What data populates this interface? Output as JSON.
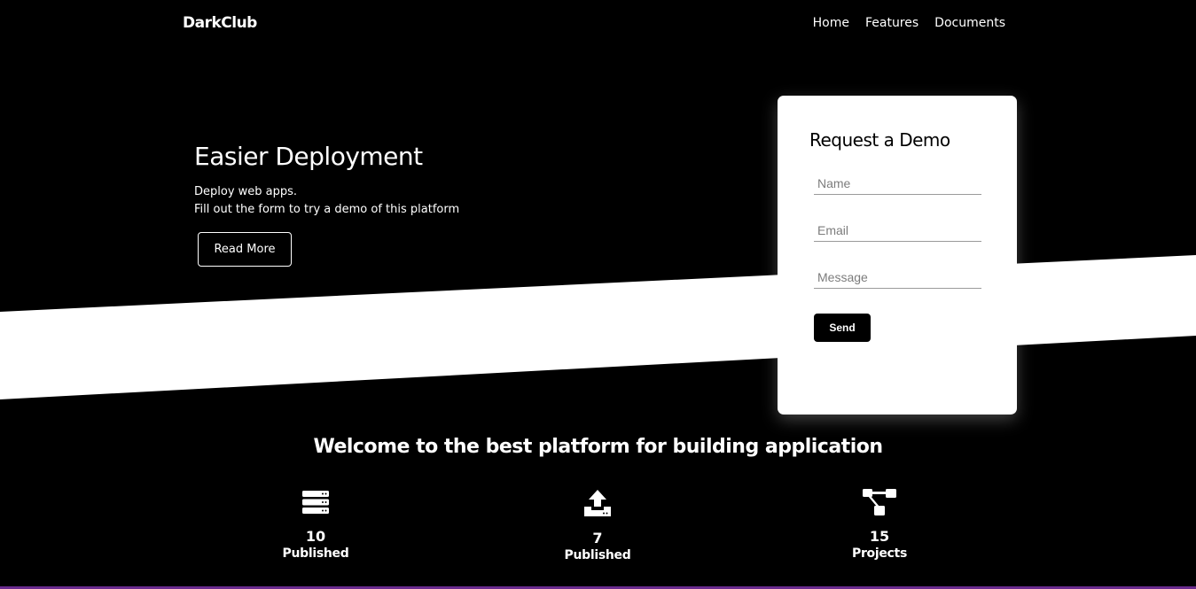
{
  "nav": {
    "brand": "DarkClub",
    "links": [
      "Home",
      "Features",
      "Documents"
    ]
  },
  "hero": {
    "title": "Easier Deployment",
    "line1": "Deploy web apps.",
    "line2": "Fill out the form to try a demo of this platform",
    "button": "Read More"
  },
  "demo_form": {
    "title": "Request a Demo",
    "name_placeholder": "Name",
    "email_placeholder": "Email",
    "message_placeholder": "Message",
    "send_label": "Send"
  },
  "welcome": "Welcome to the best platform for building application",
  "stats": [
    {
      "icon": "server-icon",
      "value": "10",
      "label": "Published"
    },
    {
      "icon": "upload-icon",
      "value": "7",
      "label": "Published"
    },
    {
      "icon": "project-diagram-icon",
      "value": "15",
      "label": "Projects"
    }
  ],
  "colors": {
    "background": "#000000",
    "card": "#ffffff",
    "accent_line": "#6a2a8e"
  }
}
